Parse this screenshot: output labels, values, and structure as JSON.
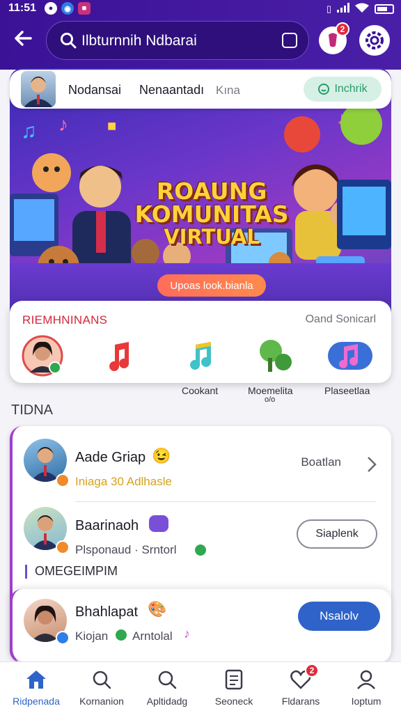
{
  "status_bar": {
    "time": "11:51"
  },
  "header": {
    "search_text": "Ilbturnnih Ndbarai",
    "notification_count": "2"
  },
  "profile_card": {
    "name": "Nodansai",
    "name2": "Nenaantadı",
    "subtitle": "Kına",
    "button_label": "Inchrik"
  },
  "banner": {
    "line1": "ROAUNG",
    "line2": "KOMUNITAS",
    "line3": "VIRTUAL",
    "link_label": "Upoas look.bianla"
  },
  "recommendations": {
    "title": "RIEMHNINANS",
    "link": "Oand Sonicarl",
    "items": [
      {
        "icon": "user-avatar-icon",
        "label": ""
      },
      {
        "icon": "music-note-red-icon",
        "label": ""
      },
      {
        "icon": "music-note-teal-icon",
        "label": "Cookant"
      },
      {
        "icon": "tree-icon",
        "label": "Moemelita"
      },
      {
        "icon": "music-note-purple-icon",
        "label": "Plaseetlaa"
      }
    ],
    "extra_label": "o/o"
  },
  "section_title": "TIDNA",
  "friends": [
    {
      "name": "Aade Griap",
      "status": "Iniaga 30 Adlhasle",
      "status_color": "#d6a21a",
      "action": "Boatlan"
    },
    {
      "name": "Baarinaoh",
      "status": "Plsponaud · Srntorl",
      "status_color": "#4a4a58",
      "action": "Siaplenk"
    }
  ],
  "subsection_title": "OMEGEIMPIM",
  "friend3": {
    "name": "Bhahlapat",
    "status": "Kiojan",
    "status2": "Arntolal",
    "action": "Nsalolv"
  },
  "bottom_nav": [
    {
      "label": "Ridpenada",
      "icon": "home-icon",
      "active": true
    },
    {
      "label": "Kornanion",
      "icon": "search-icon"
    },
    {
      "label": "Apltidadg",
      "icon": "search-icon"
    },
    {
      "label": "Seoneck",
      "icon": "document-icon"
    },
    {
      "label": "Fldarans",
      "icon": "heart-icon",
      "badge": "2"
    },
    {
      "label": "Ioptum",
      "icon": "profile-icon"
    }
  ],
  "colors": {
    "accent": "#3b1296",
    "primary_button": "#2f63c9",
    "badge": "#e12a3c"
  }
}
